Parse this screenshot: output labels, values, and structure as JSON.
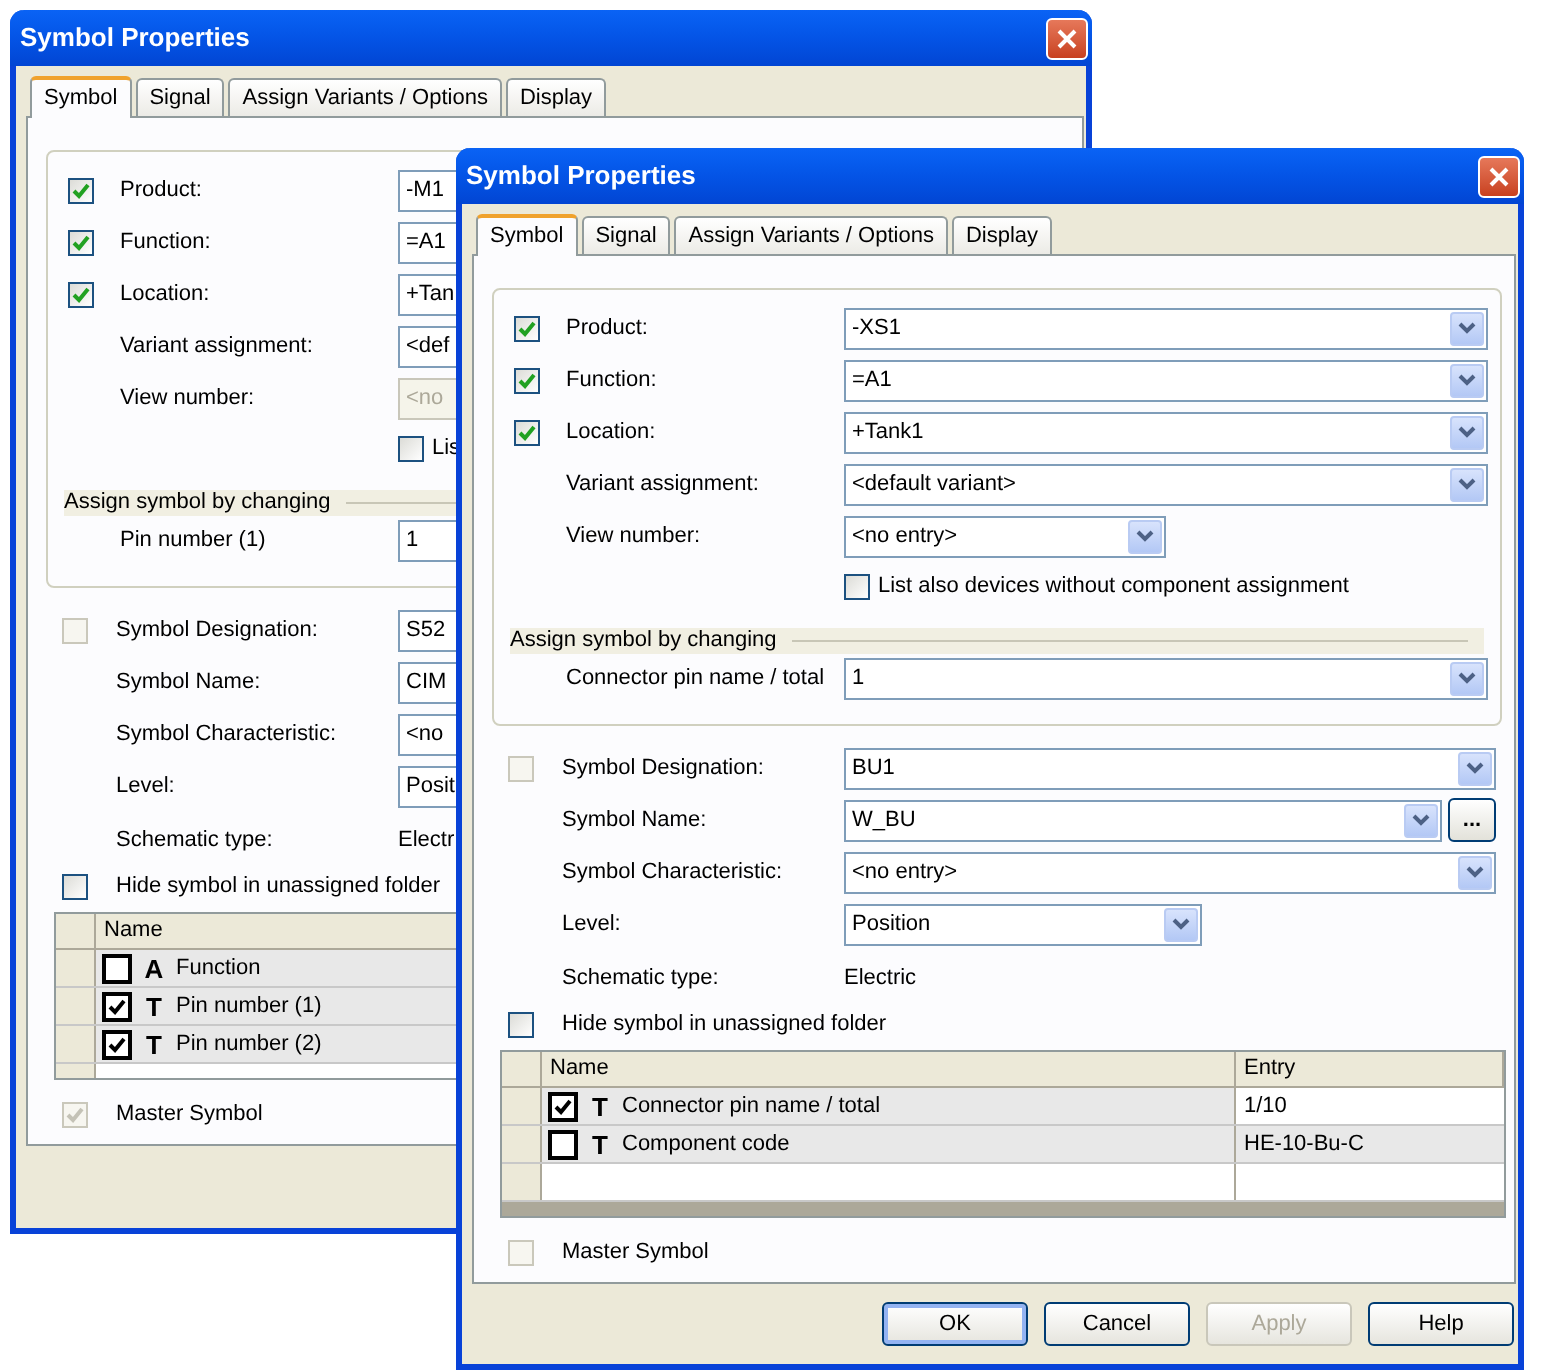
{
  "windows": [
    {
      "title": "Symbol Properties",
      "tabs": [
        {
          "label": "Symbol",
          "selected": true
        },
        {
          "label": "Signal",
          "selected": false
        },
        {
          "label": "Assign Variants / Options",
          "selected": false
        },
        {
          "label": "Display",
          "selected": false
        }
      ],
      "identifiers": [
        {
          "label": "Product:",
          "checked": true,
          "value": "-M1"
        },
        {
          "label": "Function:",
          "checked": true,
          "value": "=A1"
        },
        {
          "label": "Location:",
          "checked": true,
          "value": "+Tan"
        }
      ],
      "variant_assignment": {
        "label": "Variant assignment:",
        "value": "<def"
      },
      "view_number": {
        "label": "View number:",
        "value": "<no",
        "disabled": true
      },
      "list_devices": {
        "label": "Lis",
        "checked": false
      },
      "assign_section": {
        "title": "Assign symbol by changing",
        "label": "Pin number (1)",
        "value": "1"
      },
      "symbol_designation": {
        "label": "Symbol Designation:",
        "checked": false,
        "disabled": true,
        "value": "S52"
      },
      "symbol_name": {
        "label": "Symbol Name:",
        "value": "CIM"
      },
      "symbol_characteristic": {
        "label": "Symbol Characteristic:",
        "value": "<no"
      },
      "level": {
        "label": "Level:",
        "value": "Posit"
      },
      "schematic_type": {
        "label": "Schematic type:",
        "value": "Electr"
      },
      "hide_symbol": {
        "label": "Hide symbol in unassigned folder",
        "checked": false
      },
      "table": {
        "columns": [
          "Name"
        ],
        "rows": [
          {
            "checked": false,
            "glyph": "A",
            "name": "Function"
          },
          {
            "checked": true,
            "glyph": "T",
            "name": "Pin number (1)"
          },
          {
            "checked": true,
            "glyph": "T",
            "name": "Pin number (2)"
          }
        ]
      },
      "master_symbol": {
        "label": "Master Symbol",
        "checked": true,
        "disabled": true
      }
    },
    {
      "title": "Symbol Properties",
      "tabs": [
        {
          "label": "Symbol",
          "selected": true
        },
        {
          "label": "Signal",
          "selected": false
        },
        {
          "label": "Assign Variants / Options",
          "selected": false
        },
        {
          "label": "Display",
          "selected": false
        }
      ],
      "identifiers": [
        {
          "label": "Product:",
          "checked": true,
          "value": "-XS1"
        },
        {
          "label": "Function:",
          "checked": true,
          "value": "=A1"
        },
        {
          "label": "Location:",
          "checked": true,
          "value": "+Tank1"
        }
      ],
      "variant_assignment": {
        "label": "Variant assignment:",
        "value": "<default variant>"
      },
      "view_number": {
        "label": "View number:",
        "value": "<no entry>",
        "disabled": false
      },
      "list_devices": {
        "label": "List also devices without component assignment",
        "checked": false
      },
      "assign_section": {
        "title": "Assign symbol by changing",
        "label": "Connector pin name / total",
        "value": "1"
      },
      "symbol_designation": {
        "label": "Symbol Designation:",
        "checked": false,
        "disabled": true,
        "value": "BU1"
      },
      "symbol_name": {
        "label": "Symbol Name:",
        "value": "W_BU",
        "browse_button": "..."
      },
      "symbol_characteristic": {
        "label": "Symbol Characteristic:",
        "value": "<no entry>"
      },
      "level": {
        "label": "Level:",
        "value": "Position"
      },
      "schematic_type": {
        "label": "Schematic type:",
        "value": "Electric"
      },
      "hide_symbol": {
        "label": "Hide symbol in unassigned folder",
        "checked": false
      },
      "table": {
        "columns": [
          "Name",
          "Entry"
        ],
        "rows": [
          {
            "checked": true,
            "glyph": "T",
            "name": "Connector pin name / total",
            "entry": "1/10"
          },
          {
            "checked": false,
            "glyph": "T",
            "name": "Component code",
            "entry": "HE-10-Bu-C"
          }
        ]
      },
      "master_symbol": {
        "label": "Master Symbol",
        "checked": false,
        "disabled": true
      },
      "buttons": [
        {
          "label": "OK",
          "default": true,
          "disabled": false
        },
        {
          "label": "Cancel",
          "default": false,
          "disabled": false
        },
        {
          "label": "Apply",
          "default": false,
          "disabled": true
        },
        {
          "label": "Help",
          "default": false,
          "disabled": false
        }
      ]
    }
  ]
}
